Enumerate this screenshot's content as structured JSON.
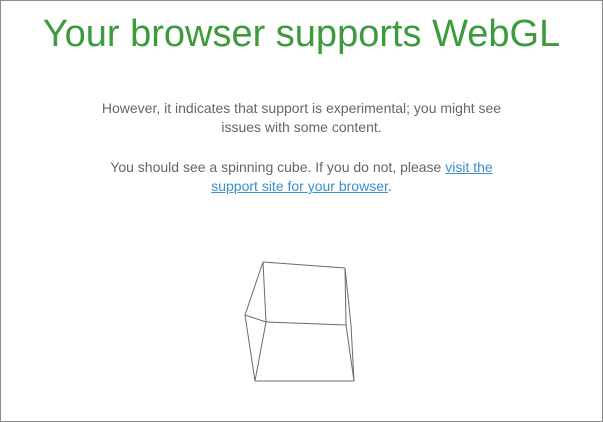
{
  "page": {
    "title": "Your browser supports WebGL",
    "experimental_notice": "However, it indicates that support is experimental; you might see issues with some content.",
    "cube_intro": "You should see a spinning cube. If you do not, please ",
    "support_link_text": "visit the support site for your browser",
    "cube_outro": "."
  },
  "cube": {
    "stroke_color": "#6b6b6b"
  },
  "colors": {
    "title": "#3c9b3c",
    "body_text": "#666666",
    "link": "#3a8fcf"
  }
}
